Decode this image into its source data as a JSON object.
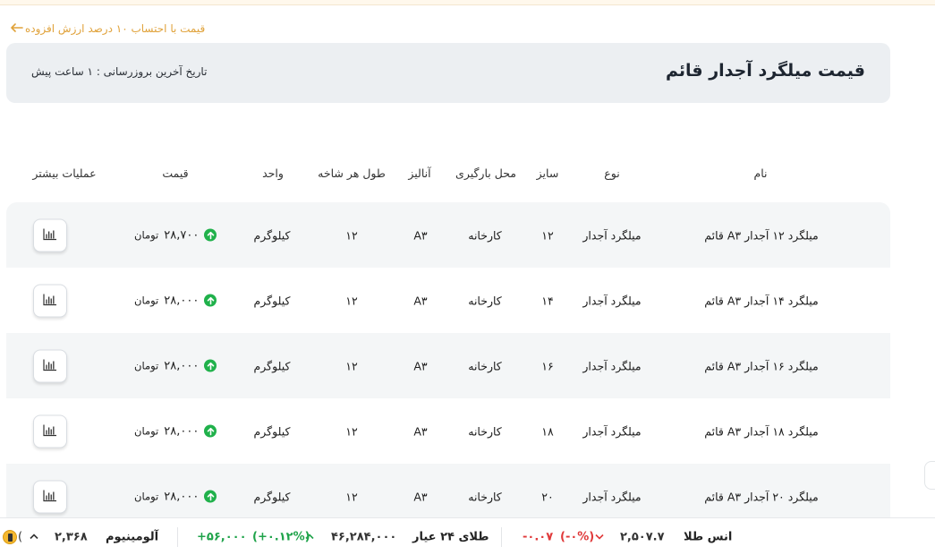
{
  "vat_link": {
    "text": "قیمت با احتساب ۱۰ درصد ارزش افزوده",
    "arrow": "🡐"
  },
  "header": {
    "title": "قیمت میلگرد آجدار قائم",
    "updated": "تاریخ آخرین بروزرسانی : ۱ ساعت پیش"
  },
  "columns": {
    "name": "نام",
    "type": "نوع",
    "size": "سایز",
    "load_place": "محل بارگیری",
    "analysis": "آنالیز",
    "branch_length": "طول هر شاخه",
    "unit": "واحد",
    "price": "قیمت",
    "more_actions": "عملیات بیشتر"
  },
  "rows": [
    {
      "name": "میلگرد ۱۲ آجدار A۳ قائم",
      "type": "میلگرد آجدار",
      "size": "۱۲",
      "load_place": "کارخانه",
      "analysis": "A۳",
      "branch_length": "۱۲",
      "unit": "کیلوگرم",
      "price": "۲۸,۷۰۰",
      "currency": "تومان",
      "trend": "up"
    },
    {
      "name": "میلگرد ۱۴ آجدار A۳ قائم",
      "type": "میلگرد آجدار",
      "size": "۱۴",
      "load_place": "کارخانه",
      "analysis": "A۳",
      "branch_length": "۱۲",
      "unit": "کیلوگرم",
      "price": "۲۸,۰۰۰",
      "currency": "تومان",
      "trend": "up"
    },
    {
      "name": "میلگرد ۱۶ آجدار A۳ قائم",
      "type": "میلگرد آجدار",
      "size": "۱۶",
      "load_place": "کارخانه",
      "analysis": "A۳",
      "branch_length": "۱۲",
      "unit": "کیلوگرم",
      "price": "۲۸,۰۰۰",
      "currency": "تومان",
      "trend": "up"
    },
    {
      "name": "میلگرد ۱۸ آجدار A۳ قائم",
      "type": "میلگرد آجدار",
      "size": "۱۸",
      "load_place": "کارخانه",
      "analysis": "A۳",
      "branch_length": "۱۲",
      "unit": "کیلوگرم",
      "price": "۲۸,۰۰۰",
      "currency": "تومان",
      "trend": "up"
    },
    {
      "name": "میلگرد ۲۰ آجدار A۳ قائم",
      "type": "میلگرد آجدار",
      "size": "۲۰",
      "load_place": "کارخانه",
      "analysis": "A۳",
      "branch_length": "۱۲",
      "unit": "کیلوگرم",
      "price": "۲۸,۰۰۰",
      "currency": "تومان",
      "trend": "up"
    }
  ],
  "ticker": {
    "gold_ounce": {
      "label": "انس طلا",
      "value": "۲,۵۰۷.۷",
      "change_pct": "(-۰%)",
      "change": "-۰.۰۷",
      "direction": "down"
    },
    "gold_24k": {
      "label": "طلای ۲۴ عیار",
      "value": "۴۶,۲۸۴,۰۰۰",
      "change_pct": "(+۰.۱۲%)",
      "change": "+۵۶,۰۰۰",
      "direction": "up"
    },
    "aluminium": {
      "label": "آلومینیوم",
      "value": "۲,۳۶۸",
      "direction": "up"
    },
    "leading_paren": "("
  },
  "icons": {
    "chart": "bar-chart-icon",
    "trend_up": "arrow-up-circle-icon",
    "chevron_up": "chevron-up-icon",
    "chevron_down": "chevron-down-icon",
    "coin": "coin-icon"
  },
  "colors": {
    "accent": "#e0a23a",
    "up": "#20b14b",
    "down": "#e0393a",
    "header_bg": "#eceff2",
    "row_alt": "#f4f6f7"
  }
}
